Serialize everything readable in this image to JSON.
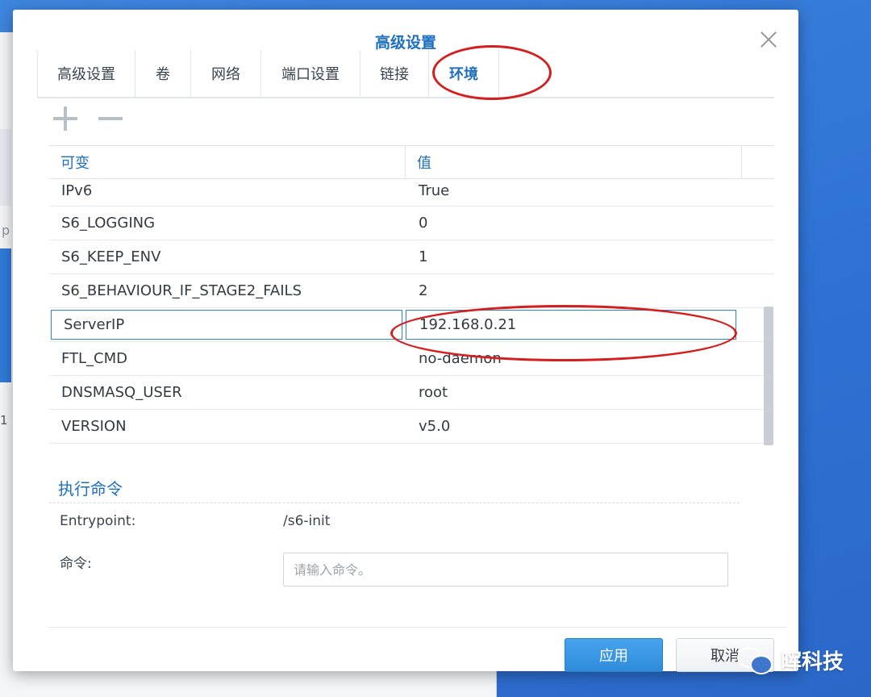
{
  "background": {
    "fragment_letter": "p",
    "fragment_digit": "1"
  },
  "dialog": {
    "title": "高级设置",
    "tabs": [
      {
        "label": "高级设置",
        "active": false
      },
      {
        "label": "卷",
        "active": false
      },
      {
        "label": "网络",
        "active": false
      },
      {
        "label": "端口设置",
        "active": false
      },
      {
        "label": "链接",
        "active": false
      },
      {
        "label": "环境",
        "active": true
      }
    ],
    "toolbar": {
      "add_icon": "plus-icon",
      "remove_icon": "minus-icon"
    },
    "env_table": {
      "headers": [
        "可变",
        "值"
      ],
      "rows": [
        {
          "variable": "IPv6",
          "value": "True"
        },
        {
          "variable": "S6_LOGGING",
          "value": "0"
        },
        {
          "variable": "S6_KEEP_ENV",
          "value": "1"
        },
        {
          "variable": "S6_BEHAVIOUR_IF_STAGE2_FAILS",
          "value": "2"
        },
        {
          "variable": "ServerIP",
          "value": "192.168.0.21"
        },
        {
          "variable": "FTL_CMD",
          "value": "no-daemon"
        },
        {
          "variable": "DNSMASQ_USER",
          "value": "root"
        },
        {
          "variable": "VERSION",
          "value": "v5.0"
        }
      ]
    },
    "exec": {
      "section_title": "执行命令",
      "entrypoint_label": "Entrypoint:",
      "entrypoint_value": "/s6-init",
      "command_label": "命令:",
      "command_placeholder": "请输入命令。",
      "command_value": ""
    },
    "buttons": {
      "apply": "应用",
      "cancel": "取消"
    }
  },
  "watermark": {
    "text": "晖科技",
    "icon": "wechat-icon"
  },
  "colors": {
    "accent": "#1d6fbf",
    "annotation": "#d51f1f",
    "apply_button": "#3a94e2"
  }
}
